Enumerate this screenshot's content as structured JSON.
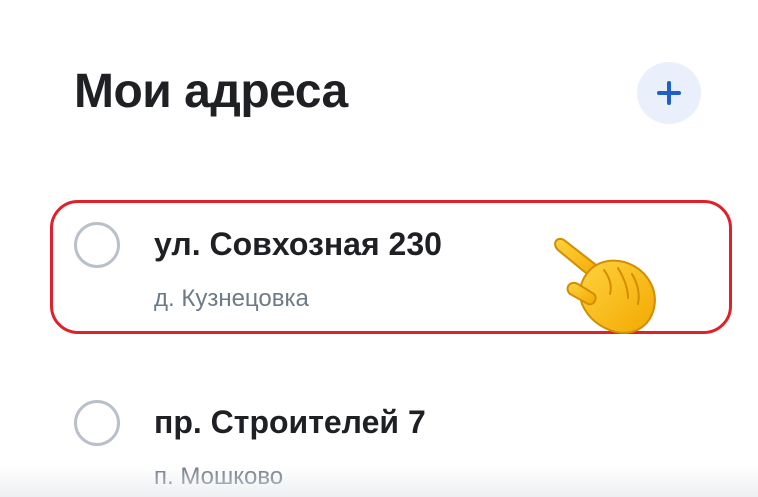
{
  "header": {
    "title": "Мои адреса",
    "add_icon": "plus-icon"
  },
  "addresses": [
    {
      "street": "ул. Совхозная 230",
      "locality": "д. Кузнецовка",
      "selected": false,
      "highlighted": true
    },
    {
      "street": "пр. Строителей 7",
      "locality": "п. Мошково",
      "selected": false,
      "highlighted": false
    }
  ],
  "colors": {
    "title": "#1f2024",
    "accent": "#1f5fc9",
    "add_button_bg": "#e9f0fb",
    "highlight_frame": "#e0202a",
    "secondary_text": "#6f7a87",
    "radio_border": "#b9c0c9"
  },
  "overlay": {
    "pointer_icon": "pointing-hand-emoji-icon"
  }
}
